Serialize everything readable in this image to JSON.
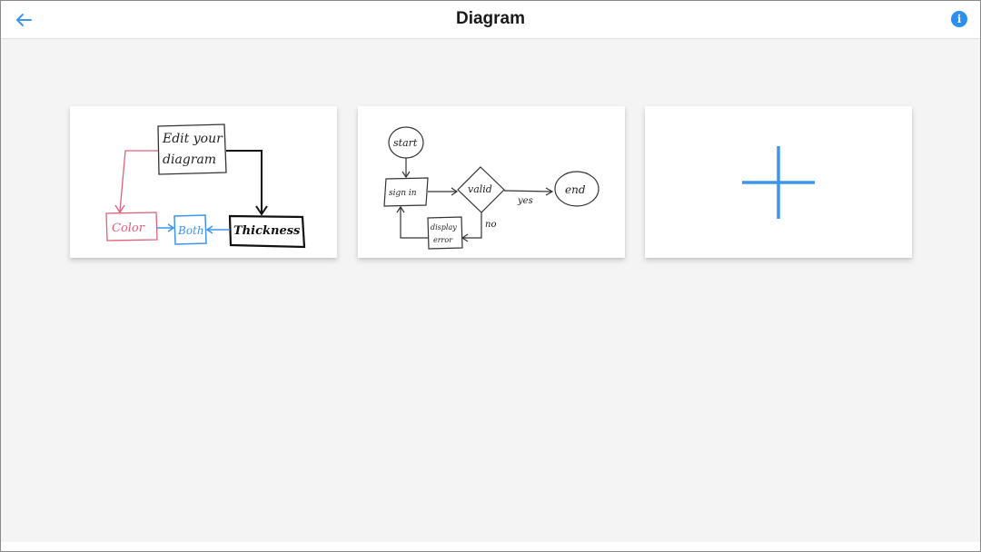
{
  "header": {
    "title": "Diagram",
    "back_icon": "arrow-left-icon",
    "info_icon": "info-icon"
  },
  "cards": [
    {
      "name": "edit-your-diagram",
      "labels": {
        "edit_line1": "Edit your",
        "edit_line2": "diagram",
        "color": "Color",
        "both": "Both",
        "thickness": "Thickness"
      }
    },
    {
      "name": "flowchart",
      "labels": {
        "start": "start",
        "sign_in": "sign in",
        "valid": "valid",
        "yes": "yes",
        "end": "end",
        "no": "no",
        "display": "display",
        "error": "error"
      }
    },
    {
      "name": "new-diagram",
      "icon": "plus-icon"
    }
  ],
  "colors": {
    "accent": "#3d95ee",
    "pink": "#e0607a",
    "ink": "#222222"
  }
}
